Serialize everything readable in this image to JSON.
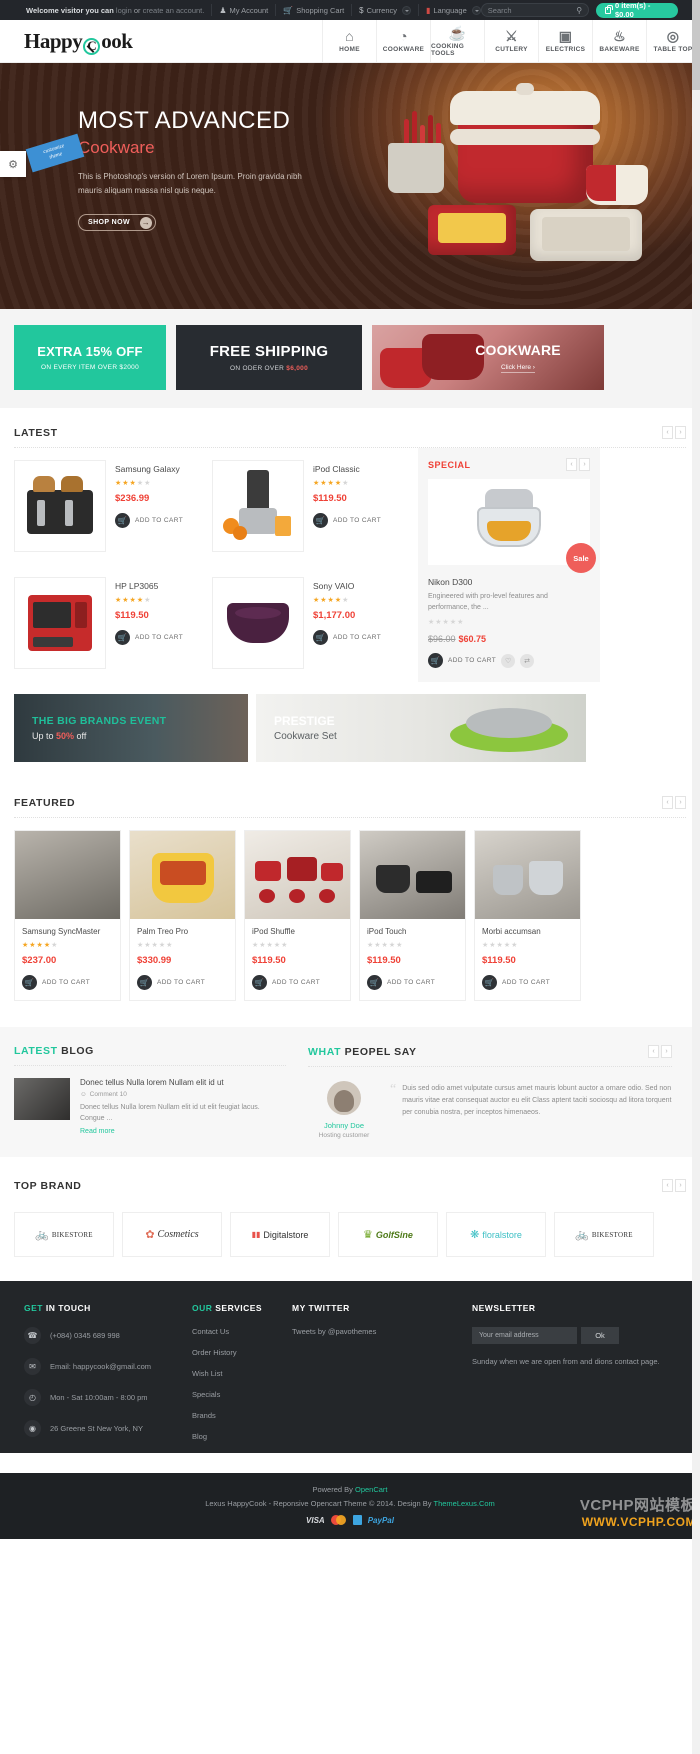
{
  "topbar": {
    "welcome_prefix": "Welcome visitor you can",
    "login": "login",
    "or": "or",
    "create": "create an account.",
    "my_account": "My Account",
    "shopping_cart": "Shopping Cart",
    "currency": "Currency",
    "currency_symbol": "$",
    "language": "Language",
    "search_placeholder": "Search",
    "cart_label": "0 item(s) - $0.00"
  },
  "header": {
    "logo_part1": "Happy",
    "logo_ring": "C",
    "logo_part2": "ook",
    "nav": [
      {
        "label": "HOME",
        "icon": "home-icon",
        "glyph": "⌂"
      },
      {
        "label": "COOKWARE",
        "icon": "cloche-icon",
        "glyph": "◔"
      },
      {
        "label": "COOKING TOOLS",
        "icon": "pot-icon",
        "glyph": "☕"
      },
      {
        "label": "CUTLERY",
        "icon": "cutlery-icon",
        "glyph": "⚔"
      },
      {
        "label": "ELECTRICS",
        "icon": "microwave-icon",
        "glyph": "▣"
      },
      {
        "label": "BAKEWARE",
        "icon": "cupcake-icon",
        "glyph": "♨"
      },
      {
        "label": "TABLE TOP",
        "icon": "plate-icon",
        "glyph": "◎"
      }
    ]
  },
  "hero": {
    "title": "MOST ADVANCED",
    "subtitle": "Cookware",
    "text": "This is Photoshop's version of Lorem Ipsum. Proin gravida nibh mauris aliquam massa nisl quis neque.",
    "button": "SHOP NOW",
    "button_arrow": "→",
    "customize_tag_line1": "customize",
    "customize_tag_line2": "theme",
    "side_tab_icon": "settings-icon"
  },
  "promos": [
    {
      "title": "EXTRA 15% OFF",
      "subtitle_pre": "ON EVERY ITEM OVER ",
      "subtitle_em": "$2000",
      "color": "#22c79d"
    },
    {
      "title": "FREE SHIPPING",
      "subtitle_pre": "ON ODER OVER ",
      "subtitle_em": "$6,000",
      "color": "#282c31"
    },
    {
      "title": "COOKWARE",
      "click_here": "Click Here  ›"
    }
  ],
  "latest": {
    "title": "LATEST",
    "prev": "‹",
    "next": "›",
    "products": [
      {
        "name": "Samsung Galaxy",
        "price": "$236.99",
        "rating": 3,
        "add_to_cart": "ADD TO CART",
        "thumb": "toaster"
      },
      {
        "name": "iPod Classic",
        "price": "$119.50",
        "rating": 4,
        "add_to_cart": "ADD TO CART",
        "thumb": "juicer"
      },
      {
        "name": "HP LP3065",
        "price": "$119.50",
        "rating": 4,
        "add_to_cart": "ADD TO CART",
        "thumb": "ovenred"
      },
      {
        "name": "Sony VAIO",
        "price": "$1,177.00",
        "rating": 4,
        "add_to_cart": "ADD TO CART",
        "thumb": "bowl"
      }
    ]
  },
  "special": {
    "title": "SPECIAL",
    "badge": "Sale",
    "name": "Nikon D300",
    "desc": "Engineered with pro-level features and performance, the ...",
    "old_price": "$96.00",
    "new_price": "$60.75",
    "add_to_cart": "ADD TO CART",
    "wishlist_icon": "heart-icon",
    "compare_icon": "compare-icon"
  },
  "midbanners": [
    {
      "line1": "THE BIG BRANDS EVENT",
      "line2_pre": "Up to ",
      "line2_em": "50%",
      "line2_post": " off"
    },
    {
      "line1": "PRESTIGE",
      "line2": "Cookware Set"
    }
  ],
  "featured": {
    "title": "FEATURED",
    "prev": "‹",
    "next": "›",
    "products": [
      {
        "name": "Samsung SyncMaster",
        "price": "$237.00",
        "rating": 4,
        "add_to_cart": "ADD TO CART"
      },
      {
        "name": "Palm Treo Pro",
        "price": "$330.99",
        "rating": 0,
        "add_to_cart": "ADD TO CART"
      },
      {
        "name": "iPod Shuffle",
        "price": "$119.50",
        "rating": 0,
        "add_to_cart": "ADD TO CART"
      },
      {
        "name": "iPod Touch",
        "price": "$119.50",
        "rating": 0,
        "add_to_cart": "ADD TO CART"
      },
      {
        "name": "Morbi accumsan",
        "price": "$119.50",
        "rating": 0,
        "add_to_cart": "ADD TO CART"
      }
    ]
  },
  "blog": {
    "title_hl": "LATEST",
    "title_rest": " BLOG",
    "post_title": "Donec tellus Nulla lorem Nullam elit id ut",
    "comment_meta": "Comment 10",
    "excerpt": "Donec tellus Nulla lorem Nullam elit id ut elit feugiat lacus. Congue ...",
    "read_more": "Read more"
  },
  "testimonial": {
    "title_hl": "WHAT",
    "title_rest": " PEOPEL SAY",
    "prev": "‹",
    "next": "›",
    "quote_mark": "“",
    "text": "Duis sed odio amet vulputate cursus amet mauris lobunt auctor a ornare odio. Sed non  mauris vitae erat consequat auctor eu elit Class aptent taciti sociosqu ad litora torquent per conubia nostra, per inceptos himenaeos.",
    "name": "Johnny Doe",
    "role": "Hosting customer"
  },
  "brands": {
    "title": "TOP BRAND",
    "prev": "‹",
    "next": "›",
    "items": [
      {
        "name": "BIKESTORE",
        "icon": "bicycle-icon"
      },
      {
        "name": "Cosmetics",
        "icon": "flower-icon"
      },
      {
        "name": "Digitalstore",
        "icon": "digital-icon"
      },
      {
        "name": "GolfSine",
        "icon": "golf-icon"
      },
      {
        "name": "floralstore",
        "icon": "floral-icon"
      },
      {
        "name": "BIKESTORE",
        "icon": "bicycle-icon"
      }
    ]
  },
  "footer": {
    "contact": {
      "title_hl": "GET",
      "title_rest": " IN TOUCH",
      "rows": [
        {
          "icon": "phone-icon",
          "glyph": "☎",
          "text": "(+084) 0345 689 998"
        },
        {
          "icon": "mail-icon",
          "glyph": "✉",
          "text": "Email: happycook@gmail.com"
        },
        {
          "icon": "clock-icon",
          "glyph": "◴",
          "text": "Mon - Sat 10:00am - 8:00 pm"
        },
        {
          "icon": "pin-icon",
          "glyph": "◉",
          "text": "26 Greene St New York, NY"
        }
      ]
    },
    "services": {
      "title_hl": "OUR",
      "title_rest": " SERVICES",
      "links": [
        "Contact Us",
        "Order History",
        "Wish List",
        "Specials",
        "Brands",
        "Blog"
      ]
    },
    "twitter": {
      "title": "MY TWITTER",
      "text": "Tweets by @pavothemes"
    },
    "newsletter": {
      "title": "NEWSLETTER",
      "placeholder": "Your email address",
      "button": "Ok",
      "text": "Sunday when we are open from and dions contact page."
    }
  },
  "copyright": {
    "powered_pre": "Powered By ",
    "powered_link": "OpenCart",
    "line2_pre": "Lexus HappyCook - Reponsive Opencart Theme © 2014. Design By ",
    "line2_link": "ThemeLexus.Com",
    "visa": "VISA",
    "paypal": "PayPal"
  },
  "watermark": {
    "line1": "VCPHP网站模板",
    "line2": "WWW.VCPHP.COM"
  }
}
